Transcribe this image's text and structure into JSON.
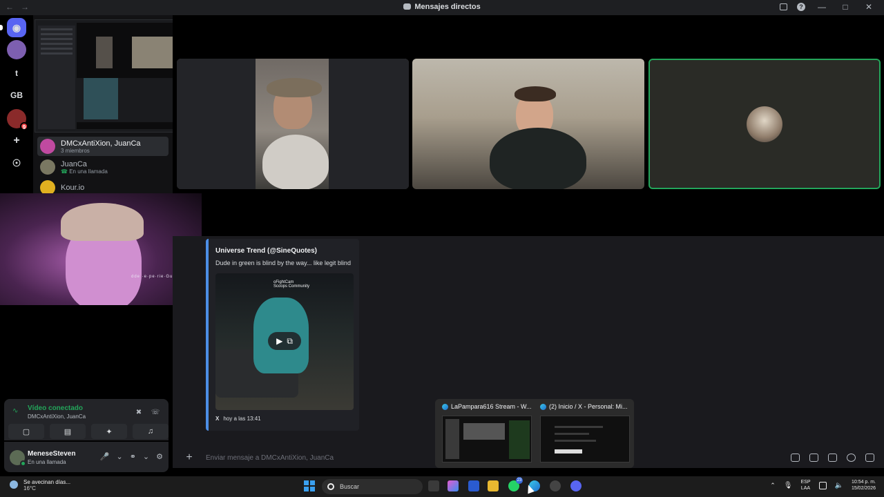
{
  "window": {
    "title": "Mensajes directos"
  },
  "servers": [
    {
      "label": "",
      "badge": ""
    },
    {
      "label": "",
      "badge": ""
    },
    {
      "label": "t",
      "badge": ""
    },
    {
      "label": "GB",
      "badge": ""
    },
    {
      "label": "",
      "badge": "9"
    },
    {
      "label": "+",
      "badge": ""
    }
  ],
  "dm_list": [
    {
      "name": "DMCxAntiXion, JuanCa",
      "sub": "3 miembros",
      "active": true
    },
    {
      "name": "JuanCa",
      "sub": "En una llamada",
      "active": false
    },
    {
      "name": "Kour.io",
      "sub": "",
      "active": false
    }
  ],
  "selfcam": {
    "overlay_text": "dde ·e·pe·rie·Gu·er"
  },
  "embed": {
    "author": "Universe Trend (@SineQuotes)",
    "description": "Dude in green is blind by the way... like legit blind",
    "media_logo": "oFightCam",
    "media_logo_sub": "Scoops Community",
    "footer_source": "X",
    "footer_time": "hoy a las 13:41"
  },
  "message_input": {
    "placeholder": "Enviar mensaje a DMCxAntiXion, JuanCa"
  },
  "voice": {
    "status": "Vídeo conectado",
    "channel": "DMCxAntiXion, JuanCa"
  },
  "user": {
    "name": "MeneseSteven",
    "status": "En una llamada"
  },
  "taskbar_previews": [
    {
      "title": "LaPampara616 Stream - W..."
    },
    {
      "title": "(2) Inicio / X - Personal: Mi..."
    }
  ],
  "taskbar": {
    "weather_text": "Se avecinan días...",
    "weather_temp": "16°C",
    "search_label": "Buscar",
    "whatsapp_badge": "23",
    "lang_top": "ESP",
    "lang_bottom": "LAA",
    "time": "10:54 p. m.",
    "date": "15/02/2026"
  },
  "colors": {
    "accent_green": "#23a55a",
    "brand_blurple": "#5865f2",
    "embed_bar": "#4c8ee6"
  }
}
